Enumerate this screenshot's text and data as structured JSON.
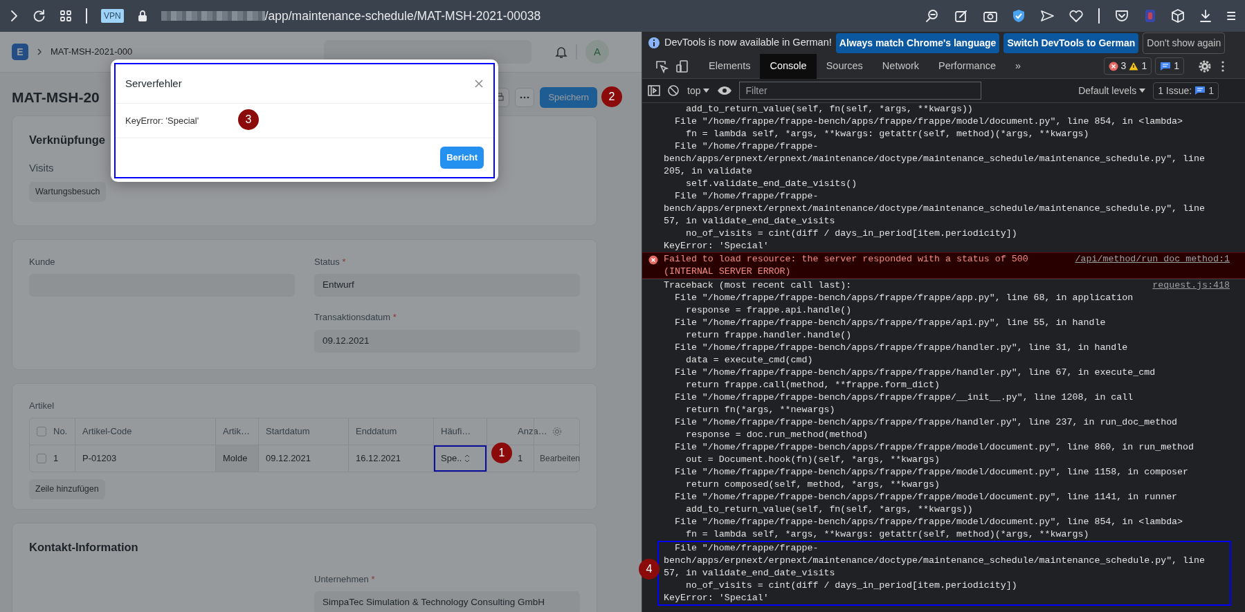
{
  "browser": {
    "vpn_label": "VPN",
    "url_path": "/app/maintenance-schedule/MAT-MSH-2021-00038"
  },
  "app": {
    "logo": "E",
    "breadcrumb": "MAT-MSH-2021-000",
    "avatar": "A",
    "title": "MAT-MSH-20",
    "save_button": "Speichern"
  },
  "links_card": {
    "title": "Verknüpfunge",
    "group_label": "Visits",
    "link_button": "Wartungsbesuch"
  },
  "details_card": {
    "left_fields": [
      {
        "label": "Kunde"
      }
    ],
    "right_fields": [
      {
        "label": "Status",
        "marker": "*",
        "value": "Entwurf"
      },
      {
        "label": "Transaktionsdatum",
        "marker": "*",
        "value": "09.12.2021"
      }
    ]
  },
  "items_card": {
    "title": "Artikel",
    "select_all_checked": false,
    "columns": [
      "No.",
      "Artikel-Code",
      "Artik…",
      "Startdatum",
      "Enddatum",
      "Häufi…",
      "Anza…"
    ],
    "rows": [
      {
        "checked": false,
        "edit_link": "Bearbeiten",
        "cells": [
          {
            "text": "1",
            "kind": "index",
            "highlighted": false
          },
          {
            "text": "P-01203",
            "kind": "field",
            "highlighted": false
          },
          {
            "text": "Molde",
            "kind": "readonly",
            "highlighted": false
          },
          {
            "text": "09.12.2021",
            "kind": "field",
            "highlighted": false
          },
          {
            "text": "16.12.2021",
            "kind": "field",
            "highlighted": false
          },
          {
            "text": "Spe..",
            "kind": "select",
            "highlighted": true
          },
          {
            "text": "1",
            "kind": "field",
            "highlighted": false
          }
        ]
      }
    ],
    "add_row_button": "Zeile hinzufügen"
  },
  "contact_card": {
    "title": "Kontakt-Information",
    "fields": [
      {
        "label": "Unternehmen",
        "marker": "*",
        "value": "SimpaTec Simulation & Technology Consulting GmbH"
      }
    ]
  },
  "modal": {
    "title": "Serverfehler",
    "message": "KeyError: 'Special'",
    "button": "Bericht",
    "highlighted": true
  },
  "devtools": {
    "infobar": {
      "text": "DevTools is now available in German!",
      "buttons": [
        {
          "label": "Always match Chrome's language",
          "kind": "primary"
        },
        {
          "label": "Switch DevTools to German",
          "kind": "primary"
        },
        {
          "label": "Don't show again",
          "kind": "secondary"
        }
      ]
    },
    "tabs": [
      {
        "label": "Elements",
        "selected": false
      },
      {
        "label": "Console",
        "selected": true
      },
      {
        "label": "Sources",
        "selected": false
      },
      {
        "label": "Network",
        "selected": false
      },
      {
        "label": "Performance",
        "selected": false
      }
    ],
    "overflow": "»",
    "counts": {
      "errors": "3",
      "warnings": "1",
      "messages": "1"
    },
    "toolbar": {
      "context": "top",
      "filter_placeholder": "Filter",
      "levels": "Default levels",
      "issues_label": "1 Issue:",
      "issues_count": "1"
    },
    "console": [
      {
        "kind": "log",
        "highlighted": false,
        "lines": [
          "    add_to_return_value(self, fn(self, *args, **kwargs))",
          "  File \"/home/frappe/frappe-bench/apps/frappe/frappe/model/document.py\", line 854, in <lambda>",
          "    fn = lambda self, *args, **kwargs: getattr(self, method)(*args, **kwargs)",
          "  File \"/home/frappe/frappe-",
          "bench/apps/erpnext/erpnext/maintenance/doctype/maintenance_schedule/maintenance_schedule.py\", line",
          "205, in validate",
          "    self.validate_end_date_visits()",
          "  File \"/home/frappe/frappe-",
          "bench/apps/erpnext/erpnext/maintenance/doctype/maintenance_schedule/maintenance_schedule.py\", line",
          "57, in validate_end_date_visits",
          "    no_of_visits = cint(diff / days_in_period[item.periodicity])",
          "KeyError: 'Special'"
        ]
      },
      {
        "kind": "error",
        "highlighted": false,
        "source": "/api/method/run_doc_method:1",
        "lines": [
          "Failed to load resource: the server responded with a status of 500",
          "(INTERNAL SERVER ERROR)"
        ]
      },
      {
        "kind": "log",
        "highlighted": false,
        "source": "request.js:418",
        "lines": [
          "Traceback (most recent call last):",
          "  File \"/home/frappe/frappe-bench/apps/frappe/frappe/app.py\", line 68, in application",
          "    response = frappe.api.handle()",
          "  File \"/home/frappe/frappe-bench/apps/frappe/frappe/api.py\", line 55, in handle",
          "    return frappe.handler.handle()",
          "  File \"/home/frappe/frappe-bench/apps/frappe/frappe/handler.py\", line 31, in handle",
          "    data = execute_cmd(cmd)",
          "  File \"/home/frappe/frappe-bench/apps/frappe/frappe/handler.py\", line 67, in execute_cmd",
          "    return frappe.call(method, **frappe.form_dict)",
          "  File \"/home/frappe/frappe-bench/apps/frappe/frappe/__init__.py\", line 1208, in call",
          "    return fn(*args, **newargs)",
          "  File \"/home/frappe/frappe-bench/apps/frappe/frappe/handler.py\", line 237, in run_doc_method",
          "    response = doc.run_method(method)",
          "  File \"/home/frappe/frappe-bench/apps/frappe/frappe/model/document.py\", line 860, in run_method",
          "    out = Document.hook(fn)(self, *args, **kwargs)",
          "  File \"/home/frappe/frappe-bench/apps/frappe/frappe/model/document.py\", line 1158, in composer",
          "    return composed(self, method, *args, **kwargs)",
          "  File \"/home/frappe/frappe-bench/apps/frappe/frappe/model/document.py\", line 1141, in runner",
          "    add_to_return_value(self, fn(self, *args, **kwargs))",
          "  File \"/home/frappe/frappe-bench/apps/frappe/frappe/model/document.py\", line 854, in <lambda>",
          "    fn = lambda self, *args, **kwargs: getattr(self, method)(*args, **kwargs)"
        ]
      },
      {
        "kind": "log",
        "highlighted": true,
        "lines": [
          "  File \"/home/frappe/frappe-",
          "bench/apps/erpnext/erpnext/maintenance/doctype/maintenance_schedule/maintenance_schedule.py\", line",
          "57, in validate_end_date_visits",
          "    no_of_visits = cint(diff / days_in_period[item.periodicity])",
          "KeyError: 'Special'"
        ]
      }
    ]
  },
  "annotations": [
    {
      "label": "1"
    },
    {
      "label": "2"
    },
    {
      "label": "3"
    },
    {
      "label": "4"
    }
  ]
}
